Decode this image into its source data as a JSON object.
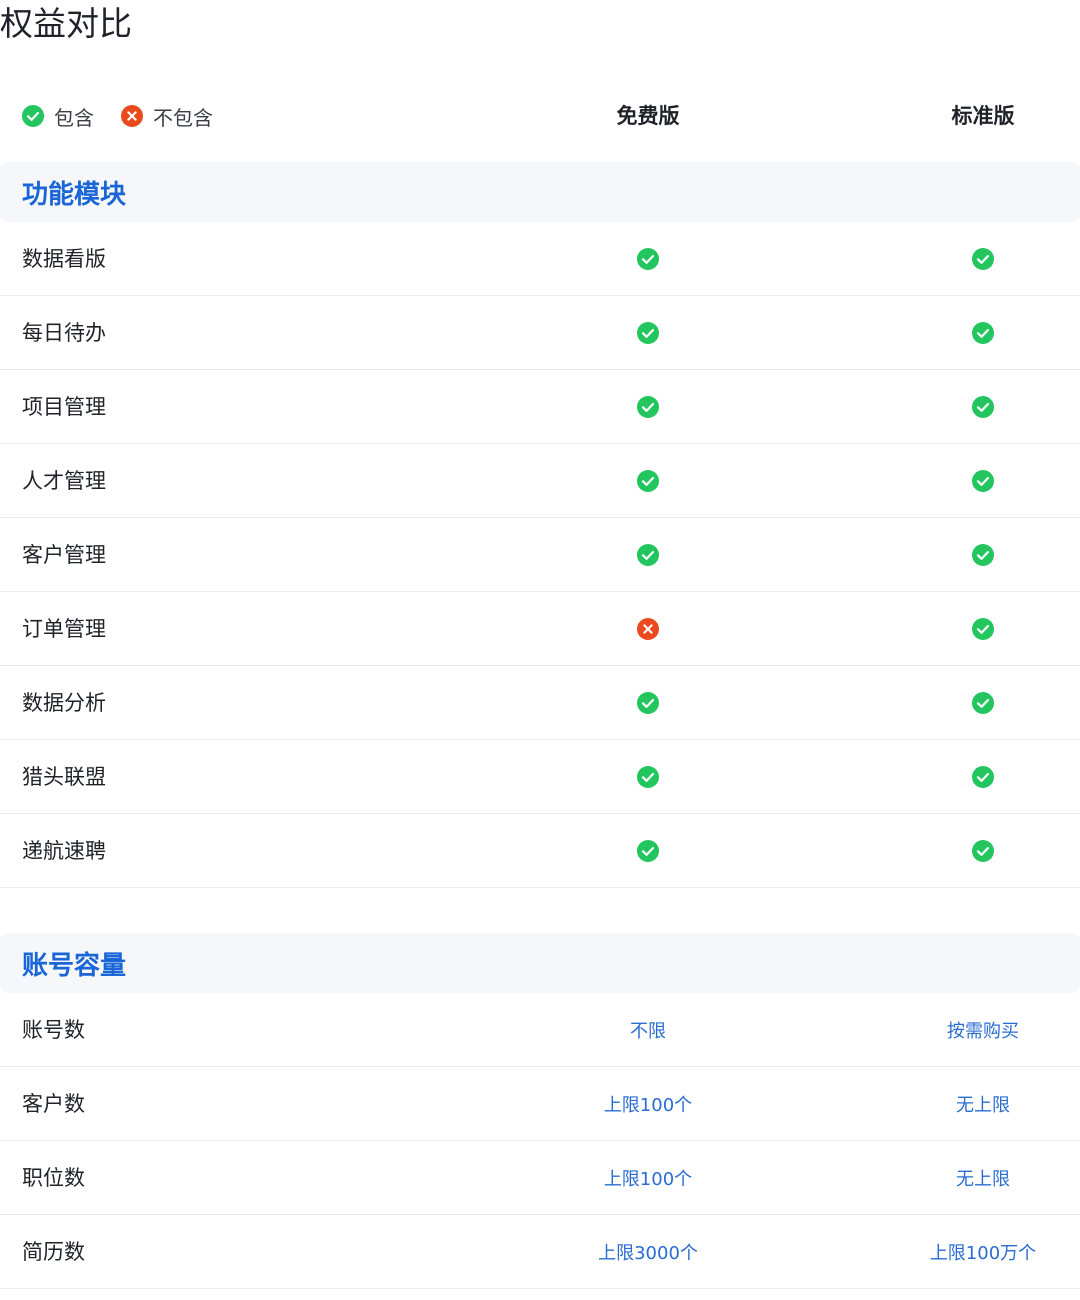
{
  "page": {
    "title": "权益对比"
  },
  "legend": {
    "included_label": "包含",
    "excluded_label": "不包含",
    "included_color": "#22c55e",
    "excluded_color": "#ea4a1d"
  },
  "columns": {
    "free": "免费版",
    "standard": "标准版"
  },
  "sections": [
    {
      "title": "功能模块",
      "rows": [
        {
          "label": "数据看版",
          "free": "check",
          "standard": "check"
        },
        {
          "label": "每日待办",
          "free": "check",
          "standard": "check"
        },
        {
          "label": "项目管理",
          "free": "check",
          "standard": "check"
        },
        {
          "label": "人才管理",
          "free": "check",
          "standard": "check"
        },
        {
          "label": "客户管理",
          "free": "check",
          "standard": "check"
        },
        {
          "label": "订单管理",
          "free": "cross",
          "standard": "check"
        },
        {
          "label": "数据分析",
          "free": "check",
          "standard": "check"
        },
        {
          "label": "猎头联盟",
          "free": "check",
          "standard": "check"
        },
        {
          "label": "递航速聘",
          "free": "check",
          "standard": "check"
        }
      ]
    },
    {
      "title": "账号容量",
      "rows": [
        {
          "label": "账号数",
          "free": "不限",
          "standard": "按需购买"
        },
        {
          "label": "客户数",
          "free": "上限100个",
          "standard": "无上限"
        },
        {
          "label": "职位数",
          "free": "上限100个",
          "standard": "无上限"
        },
        {
          "label": "简历数",
          "free": "上限3000个",
          "standard": "上限100万个"
        }
      ]
    }
  ]
}
